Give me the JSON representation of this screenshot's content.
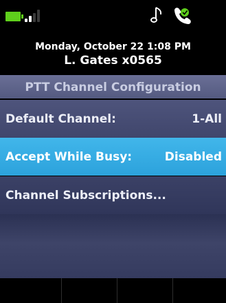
{
  "status_bar": {
    "battery_icon": "battery-icon",
    "battery_color": "#5fcf1c",
    "signal_icon": "signal-strength-icon",
    "signal_bars_active": 2,
    "signal_bars_total": 4,
    "music_icon": "music-note-icon",
    "handset_icon": "handset-icon"
  },
  "header": {
    "date_time": "Monday, October 22 1:08 PM",
    "user": "L. Gates x0565"
  },
  "screen": {
    "title": "PTT Channel Configuration"
  },
  "menu": {
    "items": [
      {
        "label": "Default Channel:",
        "value": "1-All",
        "selected": false
      },
      {
        "label": "Accept While Busy:",
        "value": "Disabled",
        "selected": true
      },
      {
        "label": "Channel Subscriptions...",
        "value": "",
        "selected": false
      }
    ]
  },
  "softkeys": {
    "labels": [
      "",
      "",
      "",
      ""
    ]
  },
  "colors": {
    "selected_row": "#2ca2dc",
    "row_background": "#40466c",
    "title_bar": "#5f648b"
  }
}
